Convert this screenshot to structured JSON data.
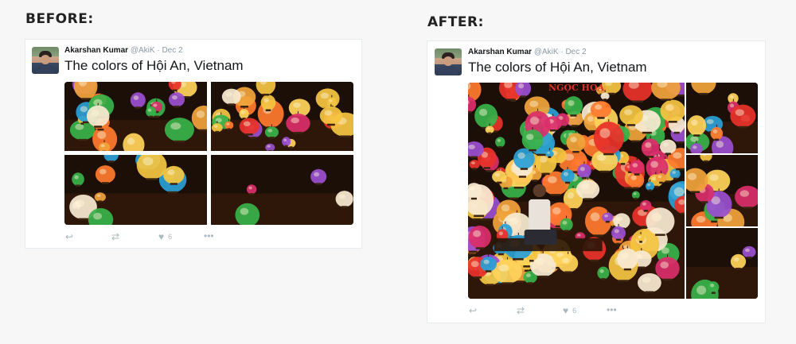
{
  "labels": {
    "before": "BEFORE:",
    "after": "AFTER:"
  },
  "tweet": {
    "author_name": "Akarshan Kumar",
    "author_handle": "@AkiK",
    "separator": "·",
    "date": "Dec 2",
    "text": "The colors of Hội An, Vietnam",
    "like_count": "6"
  },
  "after_photo_sign": "NGỌC HOA",
  "icons": {
    "reply": "reply-icon",
    "retweet": "retweet-icon",
    "like": "heart-icon",
    "more": "more-icon"
  },
  "colors": {
    "text_primary": "#14171a",
    "text_secondary": "#8899a6",
    "action_gray": "#aab8c2",
    "card_border": "#e6ecf0"
  }
}
